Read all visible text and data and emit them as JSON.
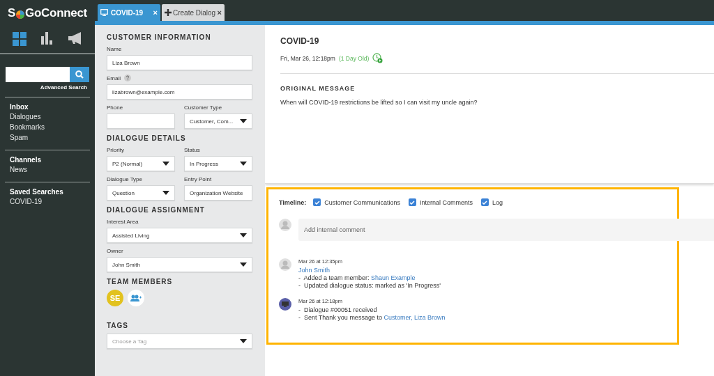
{
  "logo": {
    "before": "S",
    "after": "GoConnect"
  },
  "search": {
    "link": "Advanced Search"
  },
  "nav": [
    {
      "heading": "Inbox",
      "items": [
        "Dialogues",
        "Bookmarks",
        "Spam"
      ]
    },
    {
      "heading": "Channels",
      "items": [
        "News"
      ]
    },
    {
      "heading": "Saved Searches",
      "items": [
        "COVID-19"
      ]
    }
  ],
  "tabs": [
    {
      "kind": "dialog",
      "label": "COVID-19",
      "close": "×",
      "selected": true
    },
    {
      "kind": "create",
      "label": "Create Dialog",
      "close": "×",
      "selected": false
    }
  ],
  "form": [
    {
      "title": "CUSTOMER INFORMATION",
      "rows": [
        [
          {
            "label": "Name",
            "kind": "text",
            "value": "Liza Brown"
          }
        ],
        [
          {
            "label": "Email",
            "kind": "text",
            "help": true,
            "value": "lizabrown@example.com"
          }
        ],
        [
          {
            "label": "Phone",
            "kind": "text"
          },
          {
            "label": "Customer Type",
            "kind": "select",
            "value": "Customer, Com..."
          }
        ]
      ]
    },
    {
      "title": "DIALOGUE DETAILS",
      "rows": [
        [
          {
            "label": "Priority",
            "kind": "select",
            "value": "P2 (Normal)"
          },
          {
            "label": "Status",
            "kind": "select",
            "value": "In Progress"
          }
        ],
        [
          {
            "label": "Dialogue Type",
            "kind": "select",
            "value": "Question"
          },
          {
            "label": "Entry Point",
            "kind": "text",
            "value": "Organization Website"
          }
        ]
      ]
    },
    {
      "title": "DIALOGUE ASSIGNMENT",
      "rows": [
        [
          {
            "label": "Interest Area",
            "kind": "select",
            "value": "Assisted Living"
          }
        ],
        [
          {
            "label": "Owner",
            "kind": "select",
            "value": "John Smith"
          }
        ]
      ]
    }
  ],
  "team": {
    "title": "TEAM MEMBERS",
    "members": [
      {
        "initials": "SE",
        "color": "#e2c21f"
      }
    ]
  },
  "tags": {
    "title": "TAGS",
    "placeholder": "Choose a Tag"
  },
  "dialog": {
    "title": "COVID-19",
    "date": "Fri, Mar 26, 12:18pm",
    "age": "(1 Day Old)",
    "section": "ORIGINAL MESSAGE",
    "message": "When will COVID-19 restrictions be lifted so I can visit my uncle again?"
  },
  "timeline": {
    "label": "Timeline:",
    "filters": [
      {
        "label": "Customer Communications",
        "checked": true
      },
      {
        "label": "Internal Comments",
        "checked": true
      },
      {
        "label": "Log",
        "checked": true
      }
    ],
    "comment": {
      "placeholder": "Add internal comment"
    },
    "entries": [
      {
        "kind": "person",
        "time": "Mar 26 at 12:35pm",
        "author": "John Smith",
        "lines": [
          {
            "text": "-  Added a team member: ",
            "link": "Shaun Example"
          },
          {
            "text": "-  Updated dialogue status: marked as 'In Progress'"
          }
        ]
      },
      {
        "kind": "system",
        "time": "Mar 26 at 12:18pm",
        "lines": [
          {
            "text": "-  Dialogue #00051 received"
          },
          {
            "text": "-  Sent Thank you message to ",
            "link": "Customer, Liza Brown"
          }
        ]
      }
    ]
  }
}
